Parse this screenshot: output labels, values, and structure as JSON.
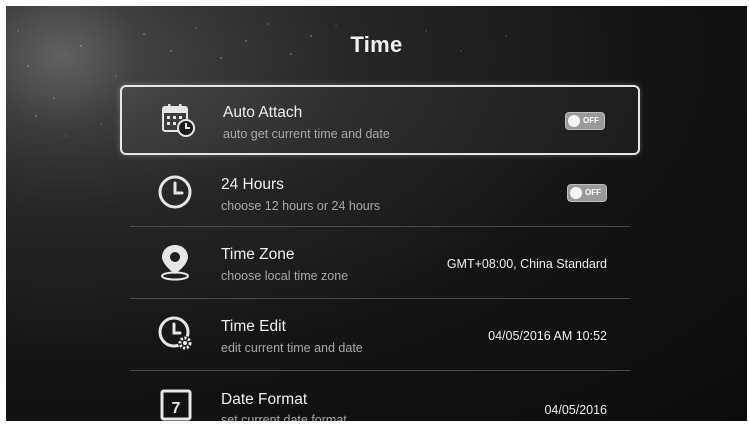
{
  "page": {
    "title": "Time"
  },
  "settings": [
    {
      "id": "auto-attach",
      "title": "Auto Attach",
      "subtitle": "auto get current time and date",
      "control": "toggle",
      "toggle_label": "OFF",
      "icon": "calendar-clock-icon",
      "selected": true
    },
    {
      "id": "24-hours",
      "title": "24 Hours",
      "subtitle": "choose 12 hours or 24 hours",
      "control": "toggle",
      "toggle_label": "OFF",
      "icon": "clock-icon"
    },
    {
      "id": "time-zone",
      "title": "Time Zone",
      "subtitle": "choose local time zone",
      "control": "value",
      "value": "GMT+08:00, China Standard",
      "icon": "location-pin-icon"
    },
    {
      "id": "time-edit",
      "title": "Time Edit",
      "subtitle": "edit current time and date",
      "control": "value",
      "value": "04/05/2016 AM 10:52",
      "icon": "clock-gear-icon"
    },
    {
      "id": "date-format",
      "title": "Date Format",
      "subtitle": "set current date format",
      "control": "value",
      "value": "04/05/2016",
      "icon": "calendar-7-icon",
      "icon_text": "7"
    }
  ],
  "colors": {
    "background": "#141414",
    "text": "#f0f0f0",
    "subtext": "#a8a8a8",
    "toggle_off": "#9a9a9a",
    "highlight_border": "#e6e6e6"
  }
}
